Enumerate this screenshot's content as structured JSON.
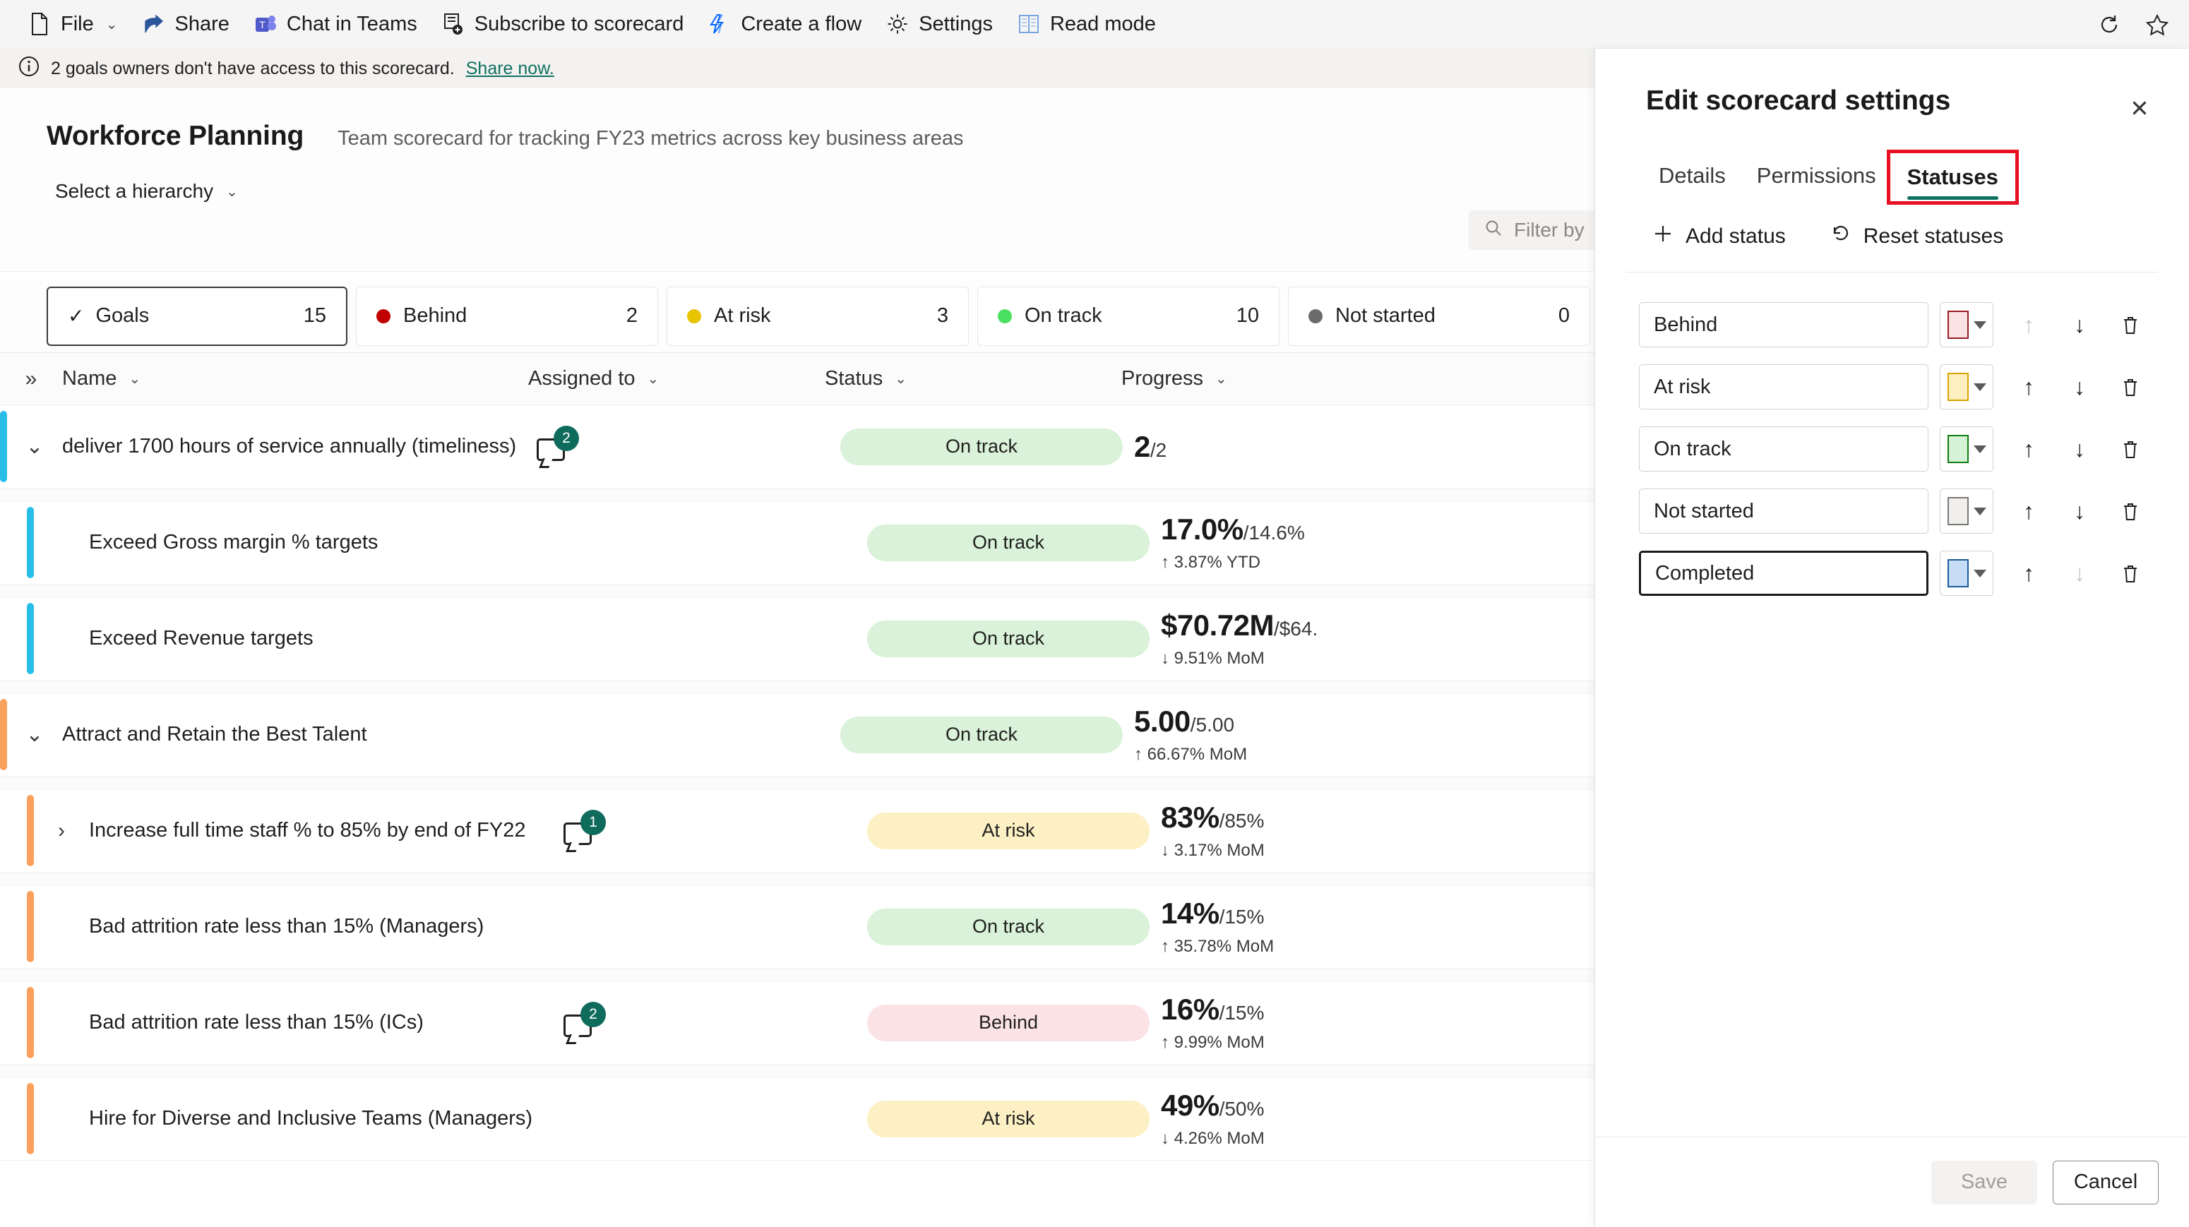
{
  "commandbar": {
    "items": [
      {
        "label": "File",
        "icon": "file-icon",
        "has_chevron": true
      },
      {
        "label": "Share",
        "icon": "share-icon",
        "has_chevron": false
      },
      {
        "label": "Chat in Teams",
        "icon": "teams-icon",
        "has_chevron": false
      },
      {
        "label": "Subscribe to scorecard",
        "icon": "subscribe-icon",
        "has_chevron": false
      },
      {
        "label": "Create a flow",
        "icon": "power-automate-icon",
        "has_chevron": false
      },
      {
        "label": "Settings",
        "icon": "gear-icon",
        "has_chevron": false
      },
      {
        "label": "Read mode",
        "icon": "read-mode-icon",
        "has_chevron": false
      }
    ],
    "right_icons": [
      "refresh-icon",
      "favorite-star-icon"
    ]
  },
  "messagebar": {
    "icon": "info-icon",
    "text": "2 goals owners don't have access to this scorecard.",
    "link": "Share now."
  },
  "scorecard": {
    "title": "Workforce Planning",
    "description": "Team scorecard for tracking FY23 metrics across key business areas",
    "hierarchy_label": "Select a hierarchy",
    "filter_placeholder": "Filter by"
  },
  "status_tabs": [
    {
      "label": "Goals",
      "count": "15",
      "color": "",
      "selected": true,
      "icon": "check-icon"
    },
    {
      "label": "Behind",
      "count": "2",
      "color": "#c00000",
      "selected": false
    },
    {
      "label": "At risk",
      "count": "3",
      "color": "#e8c300",
      "selected": false
    },
    {
      "label": "On track",
      "count": "10",
      "color": "#4ce060",
      "selected": false
    },
    {
      "label": "Not started",
      "count": "0",
      "color": "#6b6b6b",
      "selected": false
    }
  ],
  "table": {
    "columns": [
      "Name",
      "Assigned to",
      "Status",
      "Progress"
    ],
    "rows": [
      {
        "name": "deliver 1700 hours of service annually (timeliness)",
        "level": 1,
        "accent": "#29bee8",
        "expander": "chevron-down-icon",
        "comments": "2",
        "status": "On track",
        "status_class": "ontrack",
        "prog_current": "2",
        "prog_target": "/2",
        "prog_delta": ""
      },
      {
        "name": "Exceed Gross margin % targets",
        "level": 2,
        "accent": "#29bee8",
        "expander": "",
        "comments": "",
        "status": "On track",
        "status_class": "ontrack",
        "prog_current": "17.0%",
        "prog_target": "/14.6%",
        "prog_delta": "↑ 3.87% YTD"
      },
      {
        "name": "Exceed Revenue targets",
        "level": 2,
        "accent": "#29bee8",
        "expander": "",
        "comments": "",
        "status": "On track",
        "status_class": "ontrack",
        "prog_current": "$70.72M",
        "prog_target": "/$64.",
        "prog_delta": "↓ 9.51% MoM"
      },
      {
        "name": "Attract and Retain the Best Talent",
        "level": 1,
        "accent": "#f9a05c",
        "expander": "chevron-down-icon",
        "comments": "",
        "status": "On track",
        "status_class": "ontrack",
        "prog_current": "5.00",
        "prog_target": "/5.00",
        "prog_delta": "↑ 66.67% MoM"
      },
      {
        "name": "Increase full time staff % to 85% by end of FY22",
        "level": 2,
        "accent": "#f9a05c",
        "expander": "chevron-right-icon",
        "comments": "1",
        "status": "At risk",
        "status_class": "atrisk",
        "prog_current": "83%",
        "prog_target": "/85%",
        "prog_delta": "↓ 3.17% MoM"
      },
      {
        "name": "Bad attrition rate less than 15% (Managers)",
        "level": 2,
        "accent": "#f9a05c",
        "expander": "",
        "comments": "",
        "status": "On track",
        "status_class": "ontrack",
        "prog_current": "14%",
        "prog_target": "/15%",
        "prog_delta": "↑ 35.78% MoM"
      },
      {
        "name": "Bad attrition rate less than 15% (ICs)",
        "level": 2,
        "accent": "#f9a05c",
        "expander": "",
        "comments": "2",
        "status": "Behind",
        "status_class": "behind",
        "prog_current": "16%",
        "prog_target": "/15%",
        "prog_delta": "↑ 9.99% MoM"
      },
      {
        "name": "Hire for Diverse and Inclusive Teams (Managers)",
        "level": 2,
        "accent": "#f9a05c",
        "expander": "",
        "comments": "",
        "status": "At risk",
        "status_class": "atrisk",
        "prog_current": "49%",
        "prog_target": "/50%",
        "prog_delta": "↓ 4.26% MoM"
      }
    ]
  },
  "panel": {
    "title": "Edit scorecard settings",
    "close_icon": "close-icon",
    "tabs": [
      {
        "label": "Details",
        "active": false,
        "highlighted": false
      },
      {
        "label": "Permissions",
        "active": false,
        "highlighted": false
      },
      {
        "label": "Statuses",
        "active": true,
        "highlighted": true
      }
    ],
    "highlight_color": "#e81123",
    "accent_color": "#107060",
    "actions": [
      {
        "label": "Add status",
        "icon": "plus-icon"
      },
      {
        "label": "Reset statuses",
        "icon": "reset-icon"
      }
    ],
    "statuses": [
      {
        "name": "Behind",
        "fill": "#fbe3e5",
        "border": "#9b1c22",
        "up_enabled": false,
        "down_enabled": true,
        "focused": false
      },
      {
        "name": "At risk",
        "fill": "#fdefc0",
        "border": "#d9a400",
        "up_enabled": true,
        "down_enabled": true,
        "focused": false
      },
      {
        "name": "On track",
        "fill": "#d6f2d6",
        "border": "#107c10",
        "up_enabled": true,
        "down_enabled": true,
        "focused": false
      },
      {
        "name": "Not started",
        "fill": "#f0efed",
        "border": "#7a7875",
        "up_enabled": true,
        "down_enabled": true,
        "focused": false
      },
      {
        "name": "Completed",
        "fill": "#c7dcf5",
        "border": "#1b5a9e",
        "up_enabled": true,
        "down_enabled": false,
        "focused": true
      }
    ],
    "row_icons": {
      "up": "arrow-up-icon",
      "down": "arrow-down-icon",
      "delete": "trash-icon",
      "color": "color-swatch-dropdown"
    },
    "footer": {
      "save": "Save",
      "cancel": "Cancel",
      "save_disabled": true
    }
  }
}
